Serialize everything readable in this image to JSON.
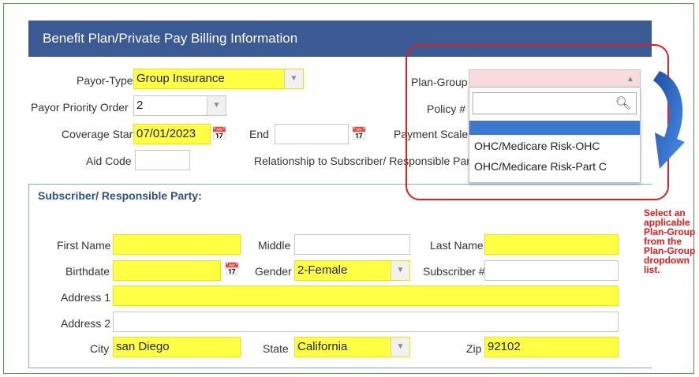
{
  "header": {
    "title": "Benefit Plan/Private Pay Billing Information"
  },
  "plan": {
    "payor_type_label": "Payor-Type",
    "payor_type_value": "Group Insurance",
    "payor_priority_label": "Payor Priority Order",
    "payor_priority_value": "2",
    "coverage_start_label": "Coverage Start",
    "coverage_start_value": "07/01/2023",
    "end_label": "End",
    "end_value": "",
    "payment_scale_label": "Payment Scale",
    "aid_code_label": "Aid Code",
    "aid_code_value": "",
    "relationship_label": "Relationship to Subscriber/ Responsible Party",
    "plan_group_label": "Plan-Group",
    "plan_group_value": "",
    "policy_label": "Policy #"
  },
  "plan_group_dropdown": {
    "search_value": "",
    "options": [
      "",
      "OHC/Medicare Risk-OHC",
      "OHC/Medicare Risk-Part C"
    ],
    "highlighted_index": 0
  },
  "subscriber": {
    "section_title": "Subscriber/ Responsible Party:",
    "first_name_label": "First Name",
    "middle_label": "Middle",
    "last_name_label": "Last Name",
    "birthdate_label": "Birthdate",
    "gender_label": "Gender",
    "gender_value": "2-Female",
    "subscriber_no_label": "Subscriber #",
    "address1_label": "Address 1",
    "address2_label": "Address 2",
    "city_label": "City",
    "city_value": "san Diego",
    "state_label": "State",
    "state_value": "California",
    "zip_label": "Zip",
    "zip_value": "92102"
  },
  "annotation": {
    "note": "Select an applicable Plan-Group from the Plan-Group dropdown list.",
    "highlight_color": "#e02020",
    "arrow_color": "#2f6fd0"
  },
  "colors": {
    "header_bg": "#3b5a93",
    "required_field": "#ffff44",
    "option_highlight": "#3d79d3"
  }
}
